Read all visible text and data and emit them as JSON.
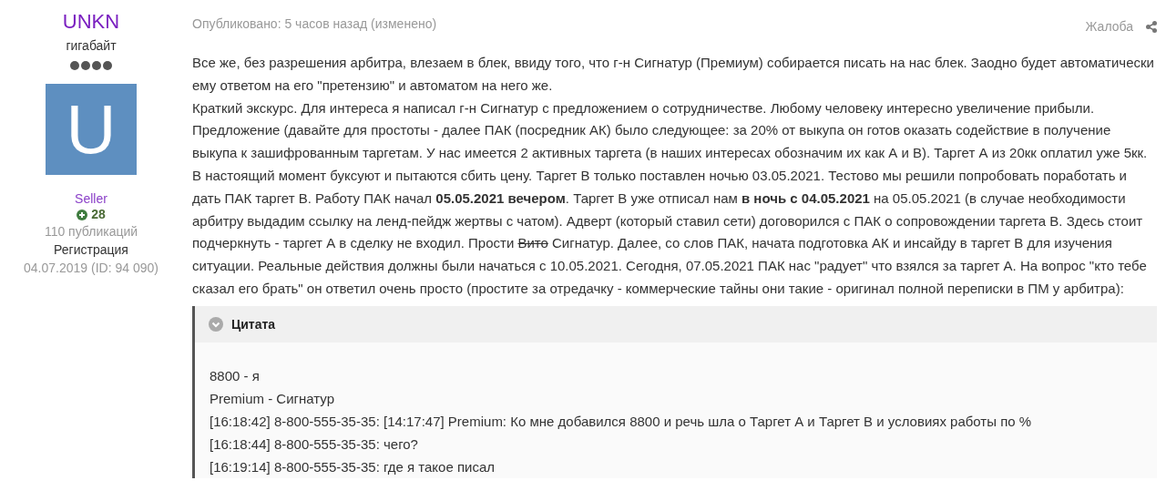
{
  "author": {
    "name": "UNKN",
    "rank": "гигабайт",
    "avatar_letter": "U",
    "group": "Seller",
    "reputation": "28",
    "posts": "110 публикаций",
    "reg_label": "Регистрация",
    "reg_value": "04.07.2019 (ID: 94 090)"
  },
  "post": {
    "published": "Опубликовано: 5 часов назад (изменено)",
    "report": "Жалоба",
    "paragraphs": [
      [
        {
          "kind": "text",
          "text": "Все же, без разрешения арбитра, влезаем в блек, ввиду того, что г-н Сигнатур (Премиум) собирается писать на нас блек. Заодно будет автоматически ему ответом на его \"претензию\" и автоматом на него же."
        }
      ],
      [
        {
          "kind": "text",
          "text": "Краткий экскурс. Для интереса я написал г-н Сигнатур с предложением о сотрудничестве. Любому человеку интересно увеличение прибыли. Предложение (давайте для простоты - далее ПАК (посредник АК) было следующее: за 20% от выкупа он готов оказать содействие в получение выкупа к зашифрованным таргетам. У нас имеется 2 активных таргета (в наших интересах обозначим их как А и В). Таргет А из 20кк оплатил уже 5кк. В настоящий момент буксуют и пытаются сбить цену. Таргет В только поставлен ночью 03.05.2021. Тестово мы решили попробовать поработать и дать ПАК таргет В. Работу ПАК начал "
        },
        {
          "kind": "bold",
          "text": "05.05.2021 вечером"
        },
        {
          "kind": "text",
          "text": ". Таргет В уже отписал нам "
        },
        {
          "kind": "bold",
          "text": "в ночь с 04.05.2021"
        },
        {
          "kind": "text",
          "text": " на 05.05.2021 (в случае необходимости арбитру выдадим ссылку на ленд-пейдж жертвы с чатом). Адверт (который ставил сети) договорился с ПАК о сопровождении таргета В. Здесь стоит подчеркнуть - таргет А в сделку не входил. Прости "
        },
        {
          "kind": "strike",
          "text": "Вито"
        },
        {
          "kind": "text",
          "text": " Сигнатур. Далее, со слов ПАК, начата подготовка АК и инсайду в таргет В для изучения ситуации. Реальные действия должны были начаться с 10.05.2021. Сегодня, 07.05.2021 ПАК нас \"радует\" что взялся за таргет А. На вопрос \"кто тебе сказал его брать\" он ответил очень просто (простите за отредачку - коммерческие тайны они такие - оригинал полной переписки в ПМ у арбитра):"
        }
      ]
    ],
    "quote": {
      "title": "Цитата",
      "expanded": false,
      "lines": [
        "8800 - я",
        "Premium - Сигнатур",
        "[16:18:42] 8-800-555-35-35: [14:17:47] Premium: Ко мне добавился 8800 и речь шла о Таргет А и Таргет В и условиях работы по %",
        "[16:18:44] 8-800-555-35-35: чего?",
        "[16:19:14] 8-800-555-35-35: где я такое писал"
      ]
    }
  }
}
